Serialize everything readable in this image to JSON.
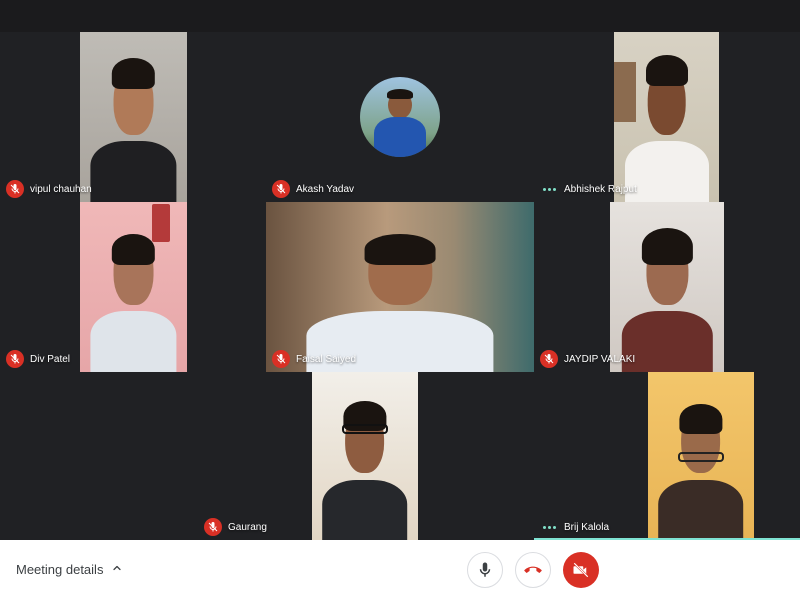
{
  "participants": [
    {
      "name": "vipul chauhan",
      "mic": "muted"
    },
    {
      "name": "Akash Yadav",
      "mic": "muted"
    },
    {
      "name": "Abhishek Rajput",
      "mic": "speaking"
    },
    {
      "name": "Div Patel",
      "mic": "muted"
    },
    {
      "name": "Faisal Saiyed",
      "mic": "muted"
    },
    {
      "name": "JAYDIP VALAKI",
      "mic": "muted"
    },
    {
      "name": "Gaurang",
      "mic": "muted"
    },
    {
      "name": "Brij Kalola",
      "mic": "speaking"
    }
  ],
  "footer": {
    "meeting_details_label": "Meeting details"
  },
  "icons": {
    "muted": "mic-off-icon",
    "speaking": "audio-dots-icon",
    "chevron": "chevron-up-icon",
    "mic": "microphone-icon",
    "hangup": "hang-up-icon",
    "camera_off": "camera-off-icon"
  },
  "colors": {
    "background": "#202124",
    "mute_red": "#d93025",
    "active_speaker": "#7fe3d3",
    "footer": "#ffffff"
  }
}
